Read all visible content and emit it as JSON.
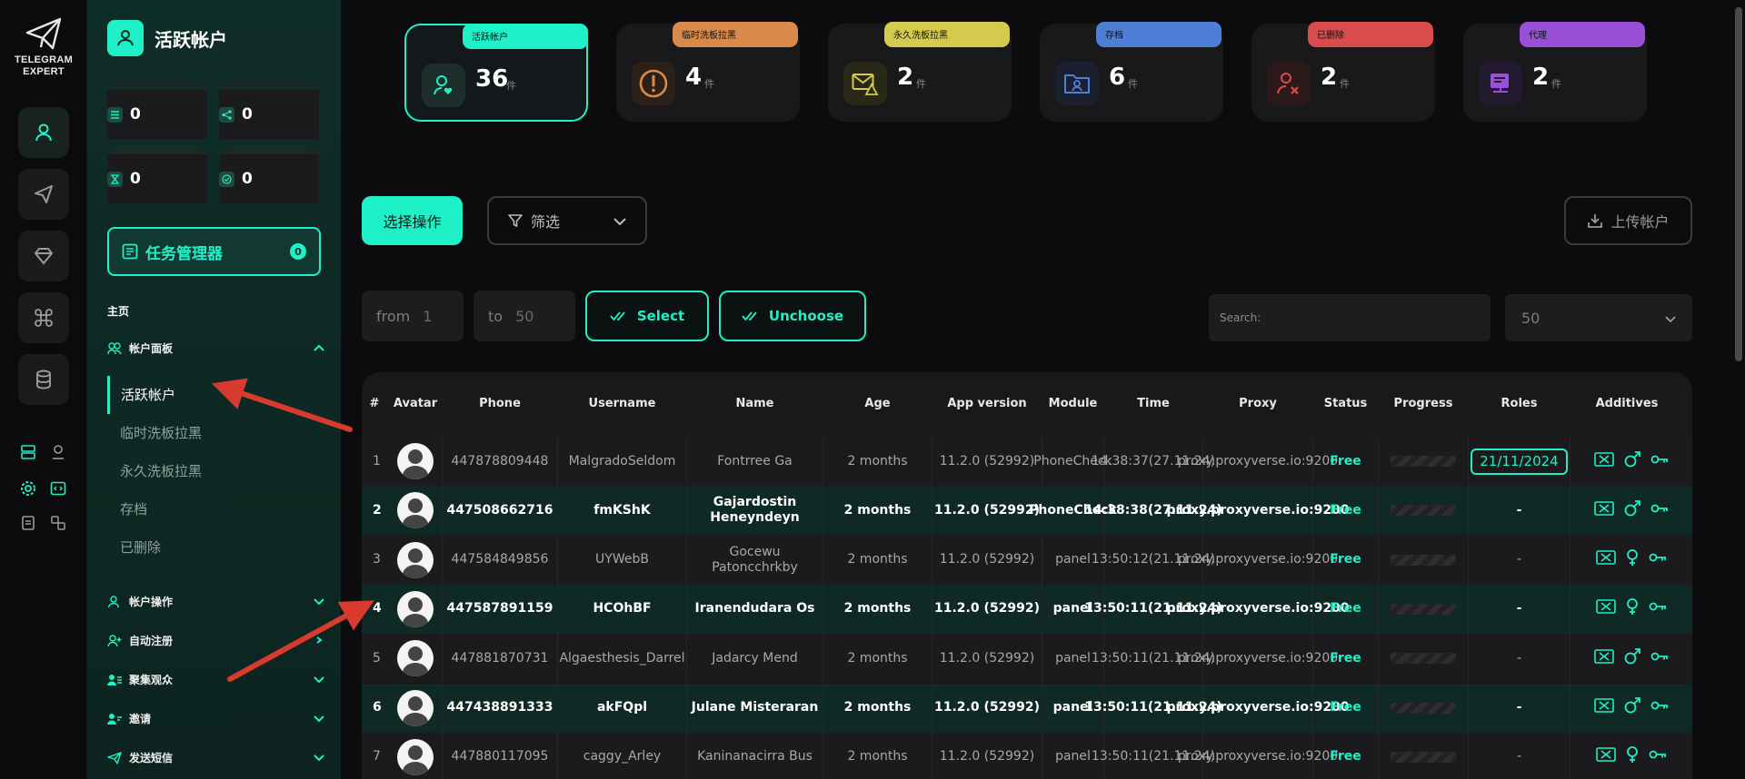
{
  "app": {
    "logo_line1": "TELEGRAM",
    "logo_line2": "EXPERT",
    "rail_icons": [
      "user-icon",
      "send-icon",
      "diamond-icon",
      "command-icon",
      "database-icon"
    ],
    "accent": "#1ef0c8"
  },
  "sidebar": {
    "title": "活跃帐户",
    "stats": [
      {
        "label": "任务",
        "value": "0"
      },
      {
        "label": "线程",
        "value": "0"
      },
      {
        "label": "等待",
        "value": "0"
      },
      {
        "label": "完成",
        "value": "0"
      }
    ],
    "task_manager": {
      "label": "任务管理器",
      "count": "0"
    },
    "home": "主页",
    "account_panel": "帐户面板",
    "sub_items": [
      "活跃帐户",
      "临时洗板拉黑",
      "永久洗板拉黑",
      "存档",
      "已删除"
    ],
    "sections": [
      "帐户操作",
      "自动注册",
      "聚集观众",
      "邀请",
      "发送短信"
    ]
  },
  "cards": [
    {
      "label": "活跃帐户",
      "count": "36",
      "unit": "件",
      "color": "#1ef0c8"
    },
    {
      "label": "临时洗板拉黑",
      "count": "4",
      "unit": "件",
      "color": "#d98a4a"
    },
    {
      "label": "永久洗板拉黑",
      "count": "2",
      "unit": "件",
      "color": "#d4cb4e"
    },
    {
      "label": "存档",
      "count": "6",
      "unit": "件",
      "color": "#4d7fd6"
    },
    {
      "label": "已删除",
      "count": "2",
      "unit": "件",
      "color": "#d84c4c"
    },
    {
      "label": "代理",
      "count": "2",
      "unit": "件",
      "color": "#9a4fd8"
    }
  ],
  "toolbar": {
    "select_action": "选择操作",
    "filter": "筛选",
    "upload": "上传帐户",
    "from_label": "from",
    "from_value": "1",
    "to_label": "to",
    "to_value": "50",
    "select": "Select",
    "unchoose": "Unchoose",
    "search_placeholder": "Search:",
    "page_size": "50"
  },
  "table": {
    "columns": [
      "#",
      "Avatar",
      "Phone",
      "Username",
      "Name",
      "Age",
      "App version",
      "Module",
      "Time",
      "Proxy",
      "Status",
      "Progress",
      "Roles",
      "Additives"
    ],
    "rows": [
      {
        "n": "1",
        "phone": "447878809448",
        "username": "MalgradoSeldom",
        "name": "Fontrree Ga",
        "age": "2 months",
        "app": "11.2.0 (52992)",
        "module": "PhoneCheck",
        "time": "14:38:37(27.11.24)",
        "proxy": "proxy.proxyverse.io:9200",
        "status": "Free",
        "role": "21/11/2024",
        "gender": "male"
      },
      {
        "n": "2",
        "phone": "447508662716",
        "username": "fmKShK",
        "name": "Gajardostin Heneyndeyn",
        "age": "2 months",
        "app": "11.2.0 (52992)",
        "module": "PhoneCheck",
        "time": "14:38:38(27.11.24)",
        "proxy": "proxy.proxyverse.io:9200",
        "status": "Free",
        "role": "-",
        "gender": "male"
      },
      {
        "n": "3",
        "phone": "447584849856",
        "username": "UYWebB",
        "name": "Gocewu Patoncchrkby",
        "age": "2 months",
        "app": "11.2.0 (52992)",
        "module": "panel",
        "time": "13:50:12(21.11.24)",
        "proxy": "proxy.proxyverse.io:9200",
        "status": "Free",
        "role": "-",
        "gender": "female"
      },
      {
        "n": "4",
        "phone": "447587891159",
        "username": "HCOhBF",
        "name": "Iranendudara Os",
        "age": "2 months",
        "app": "11.2.0 (52992)",
        "module": "panel",
        "time": "13:50:11(21.11.24)",
        "proxy": "proxy.proxyverse.io:9200",
        "status": "Free",
        "role": "-",
        "gender": "female"
      },
      {
        "n": "5",
        "phone": "447881870731",
        "username": "Algaesthesis_Darrel",
        "name": "Jadarcy Mend",
        "age": "2 months",
        "app": "11.2.0 (52992)",
        "module": "panel",
        "time": "13:50:11(21.11.24)",
        "proxy": "proxy.proxyverse.io:9200",
        "status": "Free",
        "role": "-",
        "gender": "male"
      },
      {
        "n": "6",
        "phone": "447438891333",
        "username": "akFQpl",
        "name": "Julane Misteraran",
        "age": "2 months",
        "app": "11.2.0 (52992)",
        "module": "panel",
        "time": "13:50:11(21.11.24)",
        "proxy": "proxy.proxyverse.io:9200",
        "status": "Free",
        "role": "-",
        "gender": "male"
      },
      {
        "n": "7",
        "phone": "447880117095",
        "username": "caggy_Arley",
        "name": "Kaninanacirra Bus",
        "age": "2 months",
        "app": "11.2.0 (52992)",
        "module": "panel",
        "time": "13:50:11(21.11.24)",
        "proxy": "proxy.proxyverse.io:9200",
        "status": "Free",
        "role": "-",
        "gender": "female"
      }
    ]
  }
}
